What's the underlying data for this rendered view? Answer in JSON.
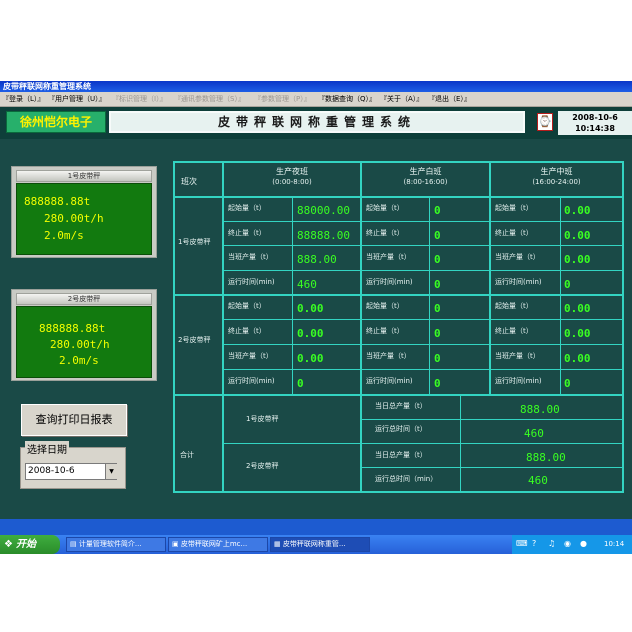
{
  "window": {
    "title": "皮带秤联网称重管理系统"
  },
  "menu": [
    {
      "label": "『登录（L）』",
      "enabled": true
    },
    {
      "label": "『用户管理（U）』",
      "enabled": true
    },
    {
      "label": "『标识管理（I）』",
      "enabled": false
    },
    {
      "label": "『通讯参数管理（S）』",
      "enabled": false
    },
    {
      "label": "『参数管理（P）』",
      "enabled": false
    },
    {
      "label": "『数据查询（Q）』",
      "enabled": true
    },
    {
      "label": "『关于（A）』",
      "enabled": true
    },
    {
      "label": "『退出（E）』",
      "enabled": true
    }
  ],
  "header": {
    "company": "徐州恺尔电子",
    "system_title": "皮带秤联网称重管理系统",
    "date": "2008-10-6",
    "time": "10:14:38"
  },
  "scales": [
    {
      "title": "1号皮带秤",
      "total": "888888.88t",
      "flow": "280.00t/h",
      "speed": "2.0m/s"
    },
    {
      "title": "2号皮带秤",
      "total": "888888.88t",
      "flow": "280.00t/h",
      "speed": "2.0m/s"
    }
  ],
  "report_button": "查询打印日报表",
  "date_picker": {
    "legend": "选择日期",
    "value": "2008-10-6"
  },
  "table": {
    "shift_header": "班次",
    "shifts": [
      {
        "name": "生产夜班",
        "time": "(0:00-8:00)"
      },
      {
        "name": "生产白班",
        "time": "(8:00-16:00)"
      },
      {
        "name": "生产中班",
        "time": "(16:00-24:00)"
      }
    ],
    "row_labels": [
      "起始量（t）",
      "终止量（t）",
      "当班产量（t）",
      "运行时间(min)"
    ],
    "groups": [
      {
        "label": "1号皮带秤",
        "values": [
          [
            "88000.00",
            "88888.00",
            "888.00",
            "460"
          ],
          [
            "0",
            "0",
            "0",
            "0"
          ],
          [
            "0.00",
            "0.00",
            "0.00",
            "0"
          ]
        ]
      },
      {
        "label": "2号皮带秤",
        "values": [
          [
            "0.00",
            "0.00",
            "0.00",
            "0"
          ],
          [
            "0",
            "0",
            "0",
            "0"
          ],
          [
            "0.00",
            "0.00",
            "0.00",
            "0"
          ]
        ]
      }
    ],
    "total": {
      "label": "合计",
      "items": [
        {
          "scale": "1号皮带秤",
          "day_output_label": "当日总产量（t）",
          "day_output": "888.00",
          "runtime_label": "运行总时间（t）",
          "runtime": "460"
        },
        {
          "scale": "2号皮带秤",
          "day_output_label": "当日总产量（t）",
          "day_output": "888.00",
          "runtime_label": "运行总时间（min）",
          "runtime": "460"
        }
      ]
    }
  },
  "taskbar": {
    "start": "开始",
    "tasks": [
      "计量管理软件简介...",
      "皮带秤联网矿上mc...",
      "皮带秤联网称重管..."
    ],
    "clock": "10:14"
  },
  "colors": {
    "panel_bg": "#1a4a47",
    "grid": "#33d4c2",
    "lcd_bg": "#127a0f",
    "lcd_text": "#f2ff00",
    "value_green": "#39ff22"
  }
}
